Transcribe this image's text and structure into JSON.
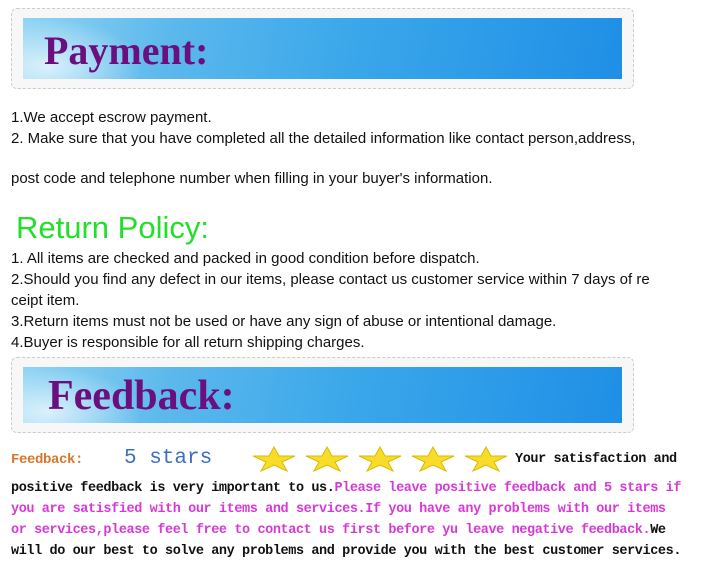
{
  "payment": {
    "title": "Payment:",
    "lines": [
      "1.We accept escrow payment.",
      "2. Make sure that you have completed all the detailed information like contact person,address,",
      "post code and telephone number when filling in your buyer's information."
    ]
  },
  "return_policy": {
    "title": "Return Policy:",
    "lines": [
      "1. All items are checked and packed in good condition before dispatch.",
      "2.Should you find any defect in our items, please contact us customer service within 7 days of re",
      "ceipt item.",
      "3.Return items must not be used or have any sign of abuse or intentional damage.",
      "4.Buyer is responsible for all return shipping charges."
    ]
  },
  "feedback": {
    "title": "Feedback:",
    "label": "Feedback:",
    "stars_text": "5 stars",
    "rating": 5,
    "text_black_1": "Your satisfaction and",
    "text_black_2": "positive feedback is very important to us.",
    "text_pink_1": "Please leave positive feedback and 5 stars if",
    "text_pink_2": "you are satisfied with our items and services.If you have any problems with our items",
    "text_pink_3": "or services,please feel free to contact us first before yu leave negative feedback.",
    "text_black_3": "We",
    "text_black_4": "will do our best to solve any problems and provide you with the best customer services."
  },
  "colors": {
    "title_purple": "#6b0f7e",
    "return_green": "#22e02a",
    "feedback_label": "#d9762a",
    "stars_text": "#3a6fc4",
    "pink": "#d63ad6"
  }
}
